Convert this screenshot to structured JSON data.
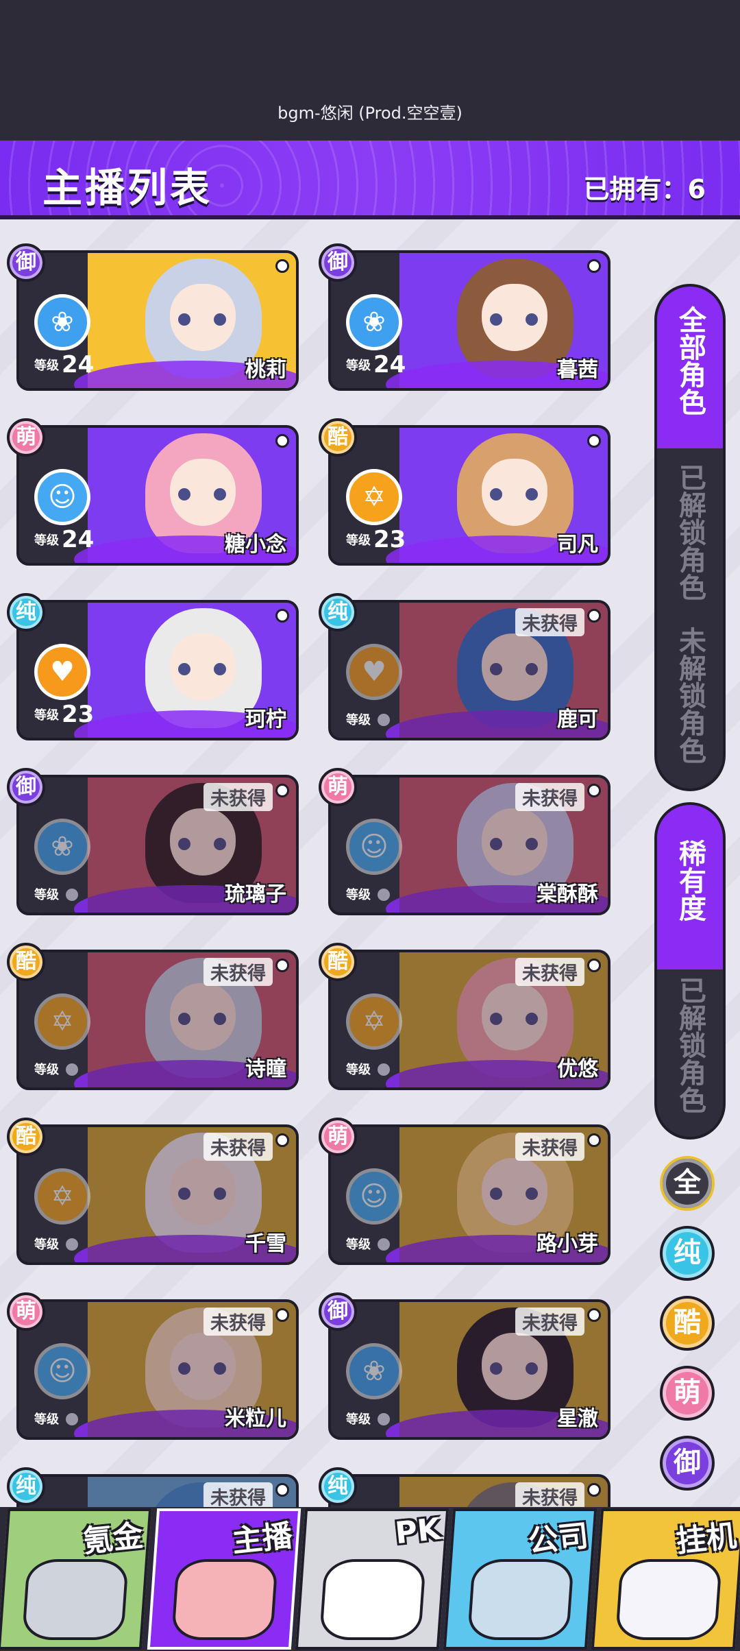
{
  "top": {
    "bgm": "bgm-悠闲 (Prod.空空壹)"
  },
  "header": {
    "title": "主播列表",
    "owned": "已拥有：6"
  },
  "cards": [
    {
      "badge": "御",
      "emblem": "rose-icon",
      "level_label": "等级",
      "level": "24",
      "name": "桃莉",
      "locked": false,
      "not_obtained": ""
    },
    {
      "badge": "御",
      "emblem": "rose-icon",
      "level_label": "等级",
      "level": "24",
      "name": "暮茜",
      "locked": false,
      "not_obtained": ""
    },
    {
      "badge": "萌",
      "emblem": "cat-icon",
      "level_label": "等级",
      "level": "24",
      "name": "糖小念",
      "locked": false,
      "not_obtained": ""
    },
    {
      "badge": "酷",
      "emblem": "star-icon",
      "level_label": "等级",
      "level": "23",
      "name": "司凡",
      "locked": false,
      "not_obtained": ""
    },
    {
      "badge": "纯",
      "emblem": "heart-icon",
      "level_label": "等级",
      "level": "23",
      "name": "珂柠",
      "locked": false,
      "not_obtained": ""
    },
    {
      "badge": "纯",
      "emblem": "heart-icon",
      "level_label": "等级",
      "level": "",
      "name": "鹿可",
      "locked": true,
      "not_obtained": "未获得"
    },
    {
      "badge": "御",
      "emblem": "rose-icon",
      "level_label": "等级",
      "level": "",
      "name": "琉璃子",
      "locked": true,
      "not_obtained": "未获得"
    },
    {
      "badge": "萌",
      "emblem": "cat-icon",
      "level_label": "等级",
      "level": "",
      "name": "棠酥酥",
      "locked": true,
      "not_obtained": "未获得"
    },
    {
      "badge": "酷",
      "emblem": "star-icon",
      "level_label": "等级",
      "level": "",
      "name": "诗瞳",
      "locked": true,
      "not_obtained": "未获得"
    },
    {
      "badge": "酷",
      "emblem": "star-icon",
      "level_label": "等级",
      "level": "",
      "name": "优悠",
      "locked": true,
      "not_obtained": "未获得"
    },
    {
      "badge": "酷",
      "emblem": "star-icon",
      "level_label": "等级",
      "level": "",
      "name": "千雪",
      "locked": true,
      "not_obtained": "未获得"
    },
    {
      "badge": "萌",
      "emblem": "cat-icon",
      "level_label": "等级",
      "level": "",
      "name": "路小芽",
      "locked": true,
      "not_obtained": "未获得"
    },
    {
      "badge": "萌",
      "emblem": "cat-icon",
      "level_label": "等级",
      "level": "",
      "name": "米粒儿",
      "locked": true,
      "not_obtained": "未获得"
    },
    {
      "badge": "御",
      "emblem": "rose-icon",
      "level_label": "等级",
      "level": "",
      "name": "星澈",
      "locked": true,
      "not_obtained": "未获得"
    },
    {
      "badge": "纯",
      "emblem": "heart-icon",
      "level_label": "",
      "level": "",
      "name": "",
      "locked": true,
      "not_obtained": "未获得"
    },
    {
      "badge": "纯",
      "emblem": "heart-icon",
      "level_label": "",
      "level": "",
      "name": "",
      "locked": true,
      "not_obtained": "未获得"
    }
  ],
  "sidebar": {
    "filter_all": "全部角色",
    "filter_unlocked": "已解锁角色",
    "filter_locked": "未解锁角色",
    "sort_rarity": "稀有度",
    "sort_unlocked": "已解锁角色",
    "types": [
      "全",
      "纯",
      "酷",
      "萌",
      "御"
    ]
  },
  "colors": {
    "御": "#7b3fe0",
    "萌": "#ef7aa8",
    "酷": "#f0a81c",
    "纯": "#39c4e6",
    "全": "#3b3946",
    "accent": "#8a2cf4"
  },
  "nav": [
    {
      "label": "氪金"
    },
    {
      "label": "主播"
    },
    {
      "label": "PK"
    },
    {
      "label": "公司"
    },
    {
      "label": "挂机"
    }
  ]
}
